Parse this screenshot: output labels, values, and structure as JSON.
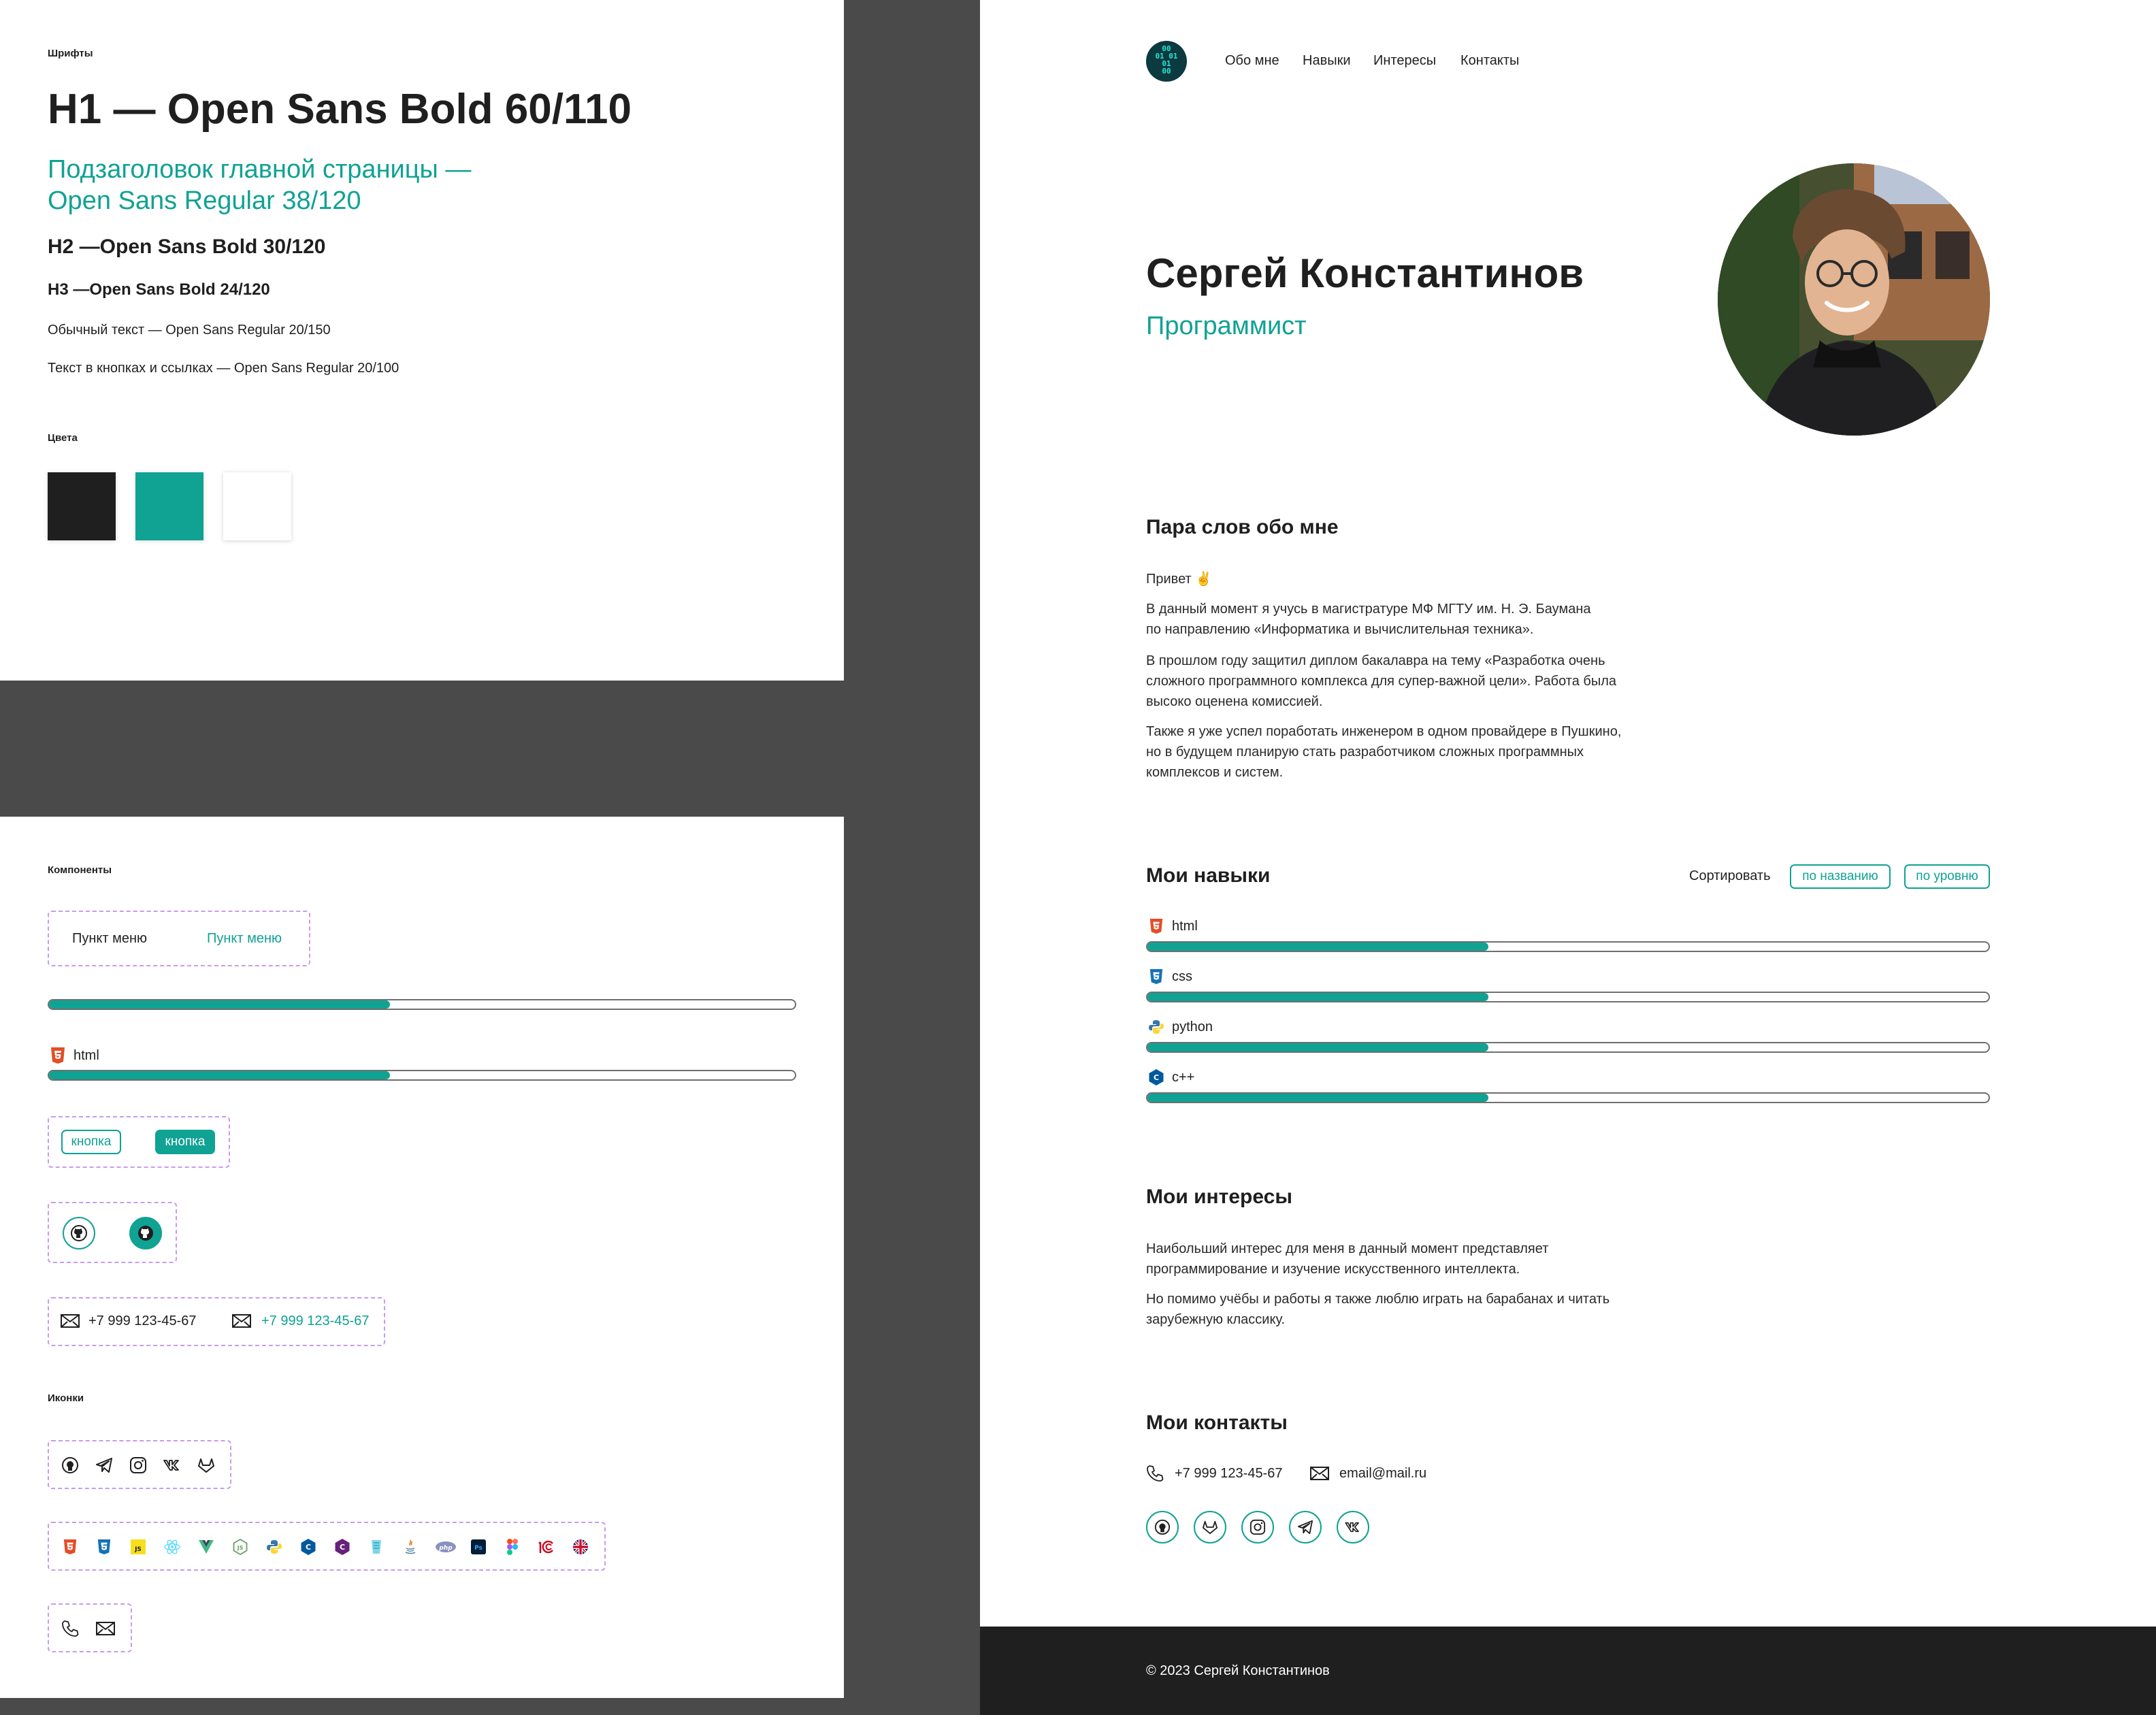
{
  "styleguide": {
    "fonts_title": "Шрифты",
    "h1_sample": "H1 — Open Sans Bold 60/110",
    "subtitle_sample": [
      "Подзаголовок главной страницы —",
      "Open Sans Regular 38/120"
    ],
    "h2_sample": "H2 —Open Sans Bold 30/120",
    "h3_sample": "H3 —Open Sans Bold 24/120",
    "body_sample": "Обычный текст — Open Sans Regular 20/150",
    "button_sample": "Текст в кнопках и ссылках — Open Sans Regular 20/100",
    "colors_title": "Цвета",
    "colors": [
      "#1f1f1f",
      "#10a293",
      "#ffffff"
    ]
  },
  "components": {
    "title": "Компоненты",
    "menu_item_default": "Пункт меню",
    "menu_item_active": "Пункт меню",
    "progress_value": 0.457,
    "skill_sample": {
      "name": "html",
      "value": 0.457
    },
    "button_outline": "кнопка",
    "button_filled": "кнопка",
    "phone_default": "+7 999 123-45-67",
    "phone_active": "+7 999 123-45-67",
    "icons_title": "Иконки"
  },
  "site": {
    "nav": [
      "Обо мне",
      "Навыки",
      "Интересы",
      "Контакты"
    ],
    "logo_text": [
      "00",
      "01 01",
      "01",
      "00"
    ],
    "hero": {
      "name": "Сергей Константинов",
      "role": "Программист"
    },
    "about": {
      "heading": "Пара слов обо мне",
      "greeting": "Привет",
      "paragraphs": [
        [
          "В данный момент я учусь в магистратуре МФ МГТУ им. Н. Э. Баумана",
          "по направлению «Информатика и вычислительная техника»."
        ],
        [
          "В прошлом году защитил диплом бакалавра на тему «Разработка очень",
          "сложного программного комплекса для супер-важной цели». Работа была",
          "высоко оценена комиссией."
        ],
        [
          "Также я уже успел поработать инженером в одном провайдере в Пушкино,",
          "но в будущем планирую стать разработчиком сложных программных",
          "комплексов и систем."
        ]
      ]
    },
    "skills": {
      "heading": "Мои навыки",
      "sort_label": "Сортировать",
      "sort_by_name": "по названию",
      "sort_by_level": "по уровню",
      "items": [
        {
          "name": "html",
          "value": 0.405,
          "icon": "html5-icon"
        },
        {
          "name": "css",
          "value": 0.405,
          "icon": "css3-icon"
        },
        {
          "name": "python",
          "value": 0.405,
          "icon": "python-icon"
        },
        {
          "name": "c++",
          "value": 0.405,
          "icon": "cpp-icon"
        }
      ]
    },
    "interests": {
      "heading": "Мои интересы",
      "paragraphs": [
        [
          "Наибольший интерес для меня в данный момент представляет",
          "программирование и изучение искусственного интеллекта."
        ],
        [
          "Но помимо учёбы и работы я также люблю играть на барабанах и читать",
          "зарубежную классику."
        ]
      ]
    },
    "contacts": {
      "heading": "Мои контакты",
      "phone": "+7 999 123-45-67",
      "email": "email@mail.ru"
    },
    "footer": "© 2023 Сергей Константинов"
  }
}
